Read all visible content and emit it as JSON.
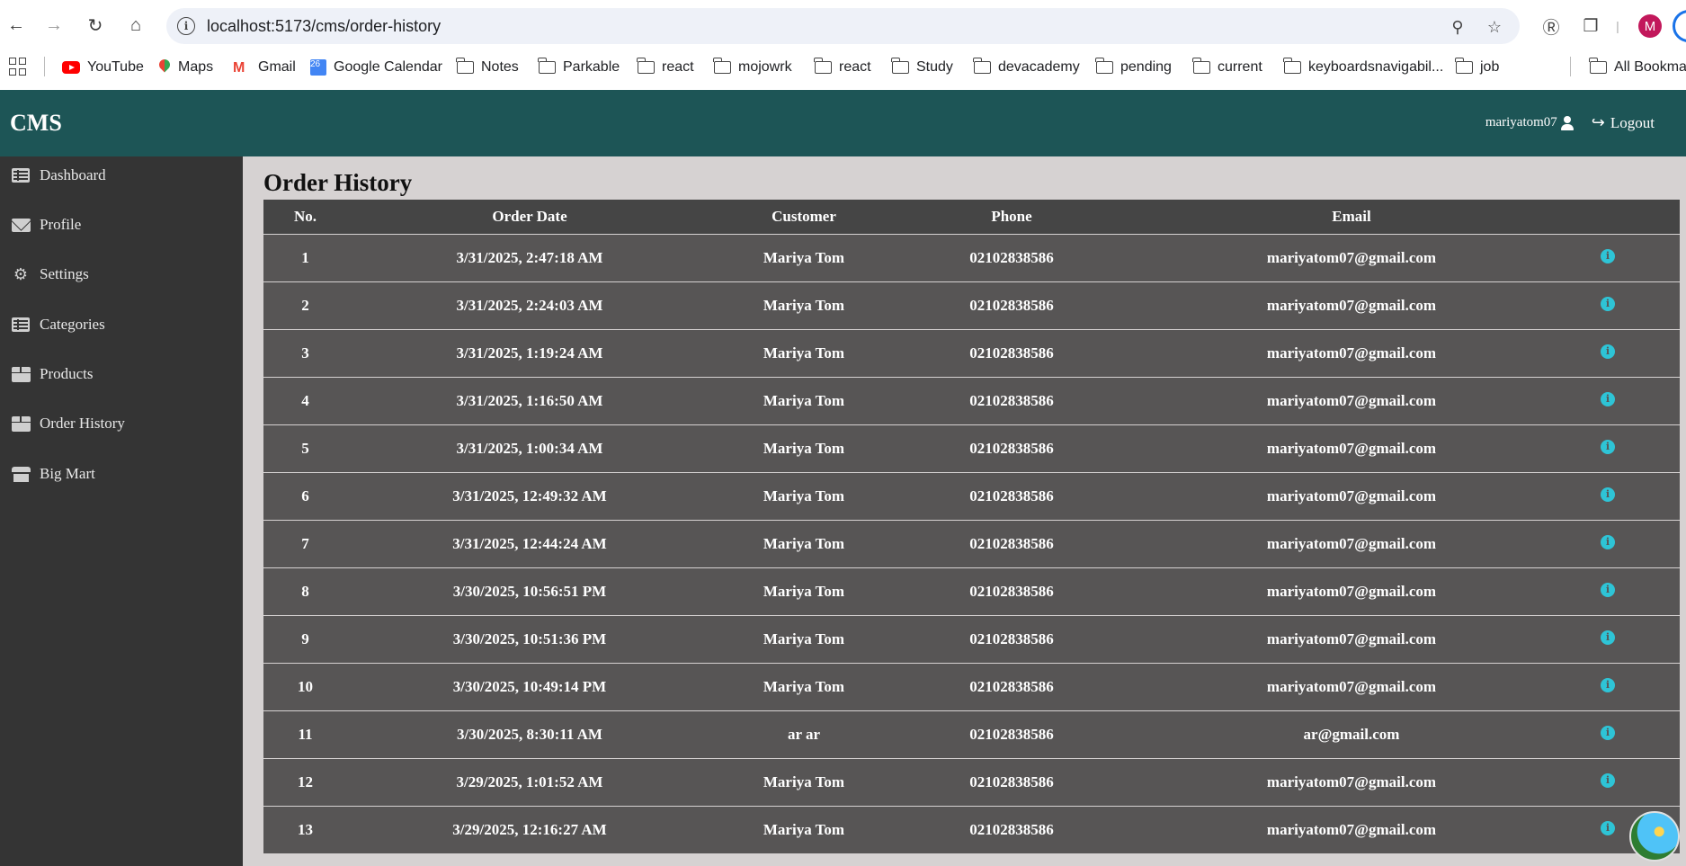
{
  "browser": {
    "url": "localhost:5173/cms/order-history",
    "profile_initial": "M",
    "bookmarks": [
      {
        "label": "YouTube",
        "icon": "youtube-icon"
      },
      {
        "label": "Maps",
        "icon": "maps-icon"
      },
      {
        "label": "Gmail",
        "icon": "gmail-icon"
      },
      {
        "label": "Google Calendar",
        "icon": "google-calendar-icon"
      },
      {
        "label": "Notes",
        "icon": "folder-icon"
      },
      {
        "label": "Parkable",
        "icon": "folder-icon"
      },
      {
        "label": "react",
        "icon": "folder-icon"
      },
      {
        "label": "mojowrk",
        "icon": "folder-icon"
      },
      {
        "label": "react",
        "icon": "folder-icon"
      },
      {
        "label": "Study",
        "icon": "folder-icon"
      },
      {
        "label": "devacademy",
        "icon": "folder-icon"
      },
      {
        "label": "pending",
        "icon": "folder-icon"
      },
      {
        "label": "current",
        "icon": "folder-icon"
      },
      {
        "label": "keyboardsnavigabil...",
        "icon": "folder-icon"
      },
      {
        "label": "job",
        "icon": "folder-icon"
      }
    ],
    "all_bookmarks": "All Bookmar",
    "calendar_day": "26"
  },
  "header": {
    "brand": "CMS",
    "username": "mariyatom07",
    "logout_label": "Logout",
    "color": "#1d5556"
  },
  "sidebar": {
    "items": [
      {
        "label": "Dashboard",
        "icon": "list-icon"
      },
      {
        "label": "Profile",
        "icon": "envelope-icon"
      },
      {
        "label": "Settings",
        "icon": "gear-icon"
      },
      {
        "label": "Categories",
        "icon": "list-icon"
      },
      {
        "label": "Products",
        "icon": "box-icon"
      },
      {
        "label": "Order History",
        "icon": "box-icon"
      },
      {
        "label": "Big Mart",
        "icon": "store-icon"
      }
    ]
  },
  "main": {
    "title": "Order History",
    "columns": [
      "No.",
      "Order Date",
      "Customer",
      "Phone",
      "Email"
    ],
    "rows": [
      {
        "no": "1",
        "date": "3/31/2025, 2:47:18 AM",
        "customer": "Mariya Tom",
        "phone": "02102838586",
        "email": "mariyatom07@gmail.com"
      },
      {
        "no": "2",
        "date": "3/31/2025, 2:24:03 AM",
        "customer": "Mariya Tom",
        "phone": "02102838586",
        "email": "mariyatom07@gmail.com"
      },
      {
        "no": "3",
        "date": "3/31/2025, 1:19:24 AM",
        "customer": "Mariya Tom",
        "phone": "02102838586",
        "email": "mariyatom07@gmail.com"
      },
      {
        "no": "4",
        "date": "3/31/2025, 1:16:50 AM",
        "customer": "Mariya Tom",
        "phone": "02102838586",
        "email": "mariyatom07@gmail.com"
      },
      {
        "no": "5",
        "date": "3/31/2025, 1:00:34 AM",
        "customer": "Mariya Tom",
        "phone": "02102838586",
        "email": "mariyatom07@gmail.com"
      },
      {
        "no": "6",
        "date": "3/31/2025, 12:49:32 AM",
        "customer": "Mariya Tom",
        "phone": "02102838586",
        "email": "mariyatom07@gmail.com"
      },
      {
        "no": "7",
        "date": "3/31/2025, 12:44:24 AM",
        "customer": "Mariya Tom",
        "phone": "02102838586",
        "email": "mariyatom07@gmail.com"
      },
      {
        "no": "8",
        "date": "3/30/2025, 10:56:51 PM",
        "customer": "Mariya Tom",
        "phone": "02102838586",
        "email": "mariyatom07@gmail.com"
      },
      {
        "no": "9",
        "date": "3/30/2025, 10:51:36 PM",
        "customer": "Mariya Tom",
        "phone": "02102838586",
        "email": "mariyatom07@gmail.com"
      },
      {
        "no": "10",
        "date": "3/30/2025, 10:49:14 PM",
        "customer": "Mariya Tom",
        "phone": "02102838586",
        "email": "mariyatom07@gmail.com"
      },
      {
        "no": "11",
        "date": "3/30/2025, 8:30:11 AM",
        "customer": "ar ar",
        "phone": "02102838586",
        "email": "ar@gmail.com"
      },
      {
        "no": "12",
        "date": "3/29/2025, 1:01:52 AM",
        "customer": "Mariya Tom",
        "phone": "02102838586",
        "email": "mariyatom07@gmail.com"
      },
      {
        "no": "13",
        "date": "3/29/2025, 12:16:27 AM",
        "customer": "Mariya Tom",
        "phone": "02102838586",
        "email": "mariyatom07@gmail.com"
      }
    ],
    "info_icon_color": "#2ec4d6"
  }
}
